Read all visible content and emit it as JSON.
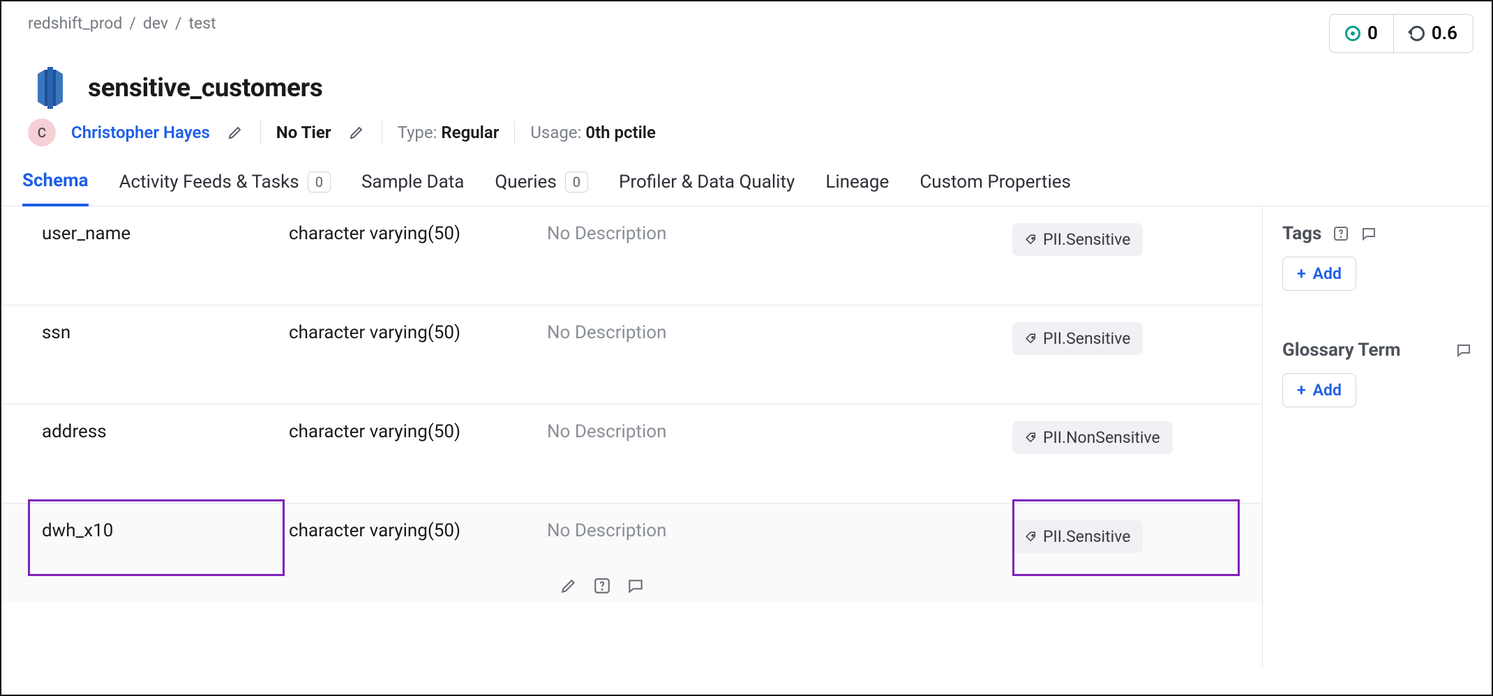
{
  "breadcrumb": [
    "redshift_prod",
    "dev",
    "test"
  ],
  "badges": {
    "target_value": "0",
    "history_value": "0.6"
  },
  "title": "sensitive_customers",
  "owner": {
    "initial": "C",
    "name": "Christopher Hayes"
  },
  "tier": "No Tier",
  "type_label": "Type:",
  "type_value": "Regular",
  "usage_label": "Usage:",
  "usage_value": "0th pctile",
  "tabs": [
    {
      "label": "Schema",
      "active": true
    },
    {
      "label": "Activity Feeds & Tasks",
      "count": "0"
    },
    {
      "label": "Sample Data"
    },
    {
      "label": "Queries",
      "count": "0"
    },
    {
      "label": "Profiler & Data Quality"
    },
    {
      "label": "Lineage"
    },
    {
      "label": "Custom Properties"
    }
  ],
  "columns": [
    {
      "name": "user_name",
      "type": "character varying(50)",
      "desc": "No Description",
      "tag": "PII.Sensitive"
    },
    {
      "name": "ssn",
      "type": "character varying(50)",
      "desc": "No Description",
      "tag": "PII.Sensitive"
    },
    {
      "name": "address",
      "type": "character varying(50)",
      "desc": "No Description",
      "tag": "PII.NonSensitive"
    },
    {
      "name": "dwh_x10",
      "type": "character varying(50)",
      "desc": "No Description",
      "tag": "PII.Sensitive",
      "highlighted": true,
      "actions": true
    }
  ],
  "side": {
    "tags_title": "Tags",
    "glossary_title": "Glossary Term",
    "add_label": "Add"
  }
}
